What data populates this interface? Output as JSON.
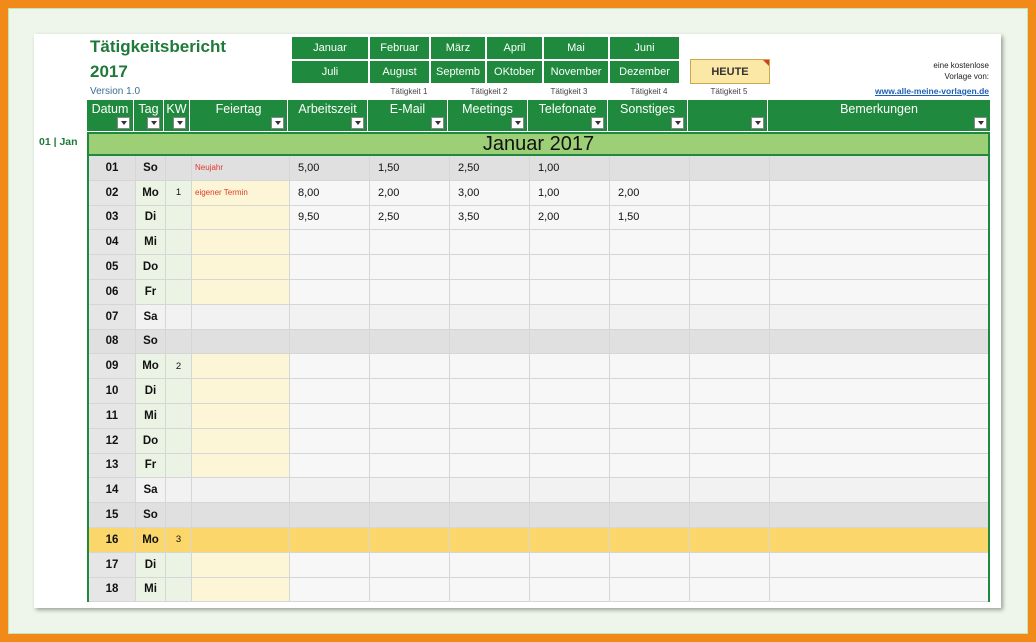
{
  "header": {
    "title_line1": "Tätigkeitsbericht",
    "title_line2": "2017",
    "version": "Version 1.0"
  },
  "months_row1": [
    "Januar",
    "Februar",
    "März",
    "April",
    "Mai",
    "Juni"
  ],
  "months_row2": [
    "Juli",
    "August",
    "Septemb",
    "OKtober",
    "November",
    "Dezember"
  ],
  "today_button": "HEUTE",
  "promo": {
    "line1": "eine kostenlose",
    "line2": "Vorlage von:",
    "link": "www.alle-meine-vorlagen.de"
  },
  "activity_labels": [
    "Tätigkeit 1",
    "Tätigkeit 2",
    "Tätigkeit 3",
    "Tätigkeit 4",
    "Tätigkeit 5"
  ],
  "columns": [
    "Datum",
    "Tag",
    "KW",
    "Feiertag",
    "Arbeitszeit",
    "E-Mail",
    "Meetings",
    "Telefonate",
    "Sonstiges",
    "",
    "Bemerkungen"
  ],
  "side_label": "01 | Jan",
  "month_title": "Januar 2017",
  "rows": [
    {
      "datum": "01",
      "tag": "So",
      "kw": "",
      "feiertag": "Neujahr",
      "arbeitszeit": "5,00",
      "email": "1,50",
      "meetings": "2,50",
      "telefonate": "1,00",
      "sonstiges": "",
      "t5": "",
      "bem": "",
      "kind": "sunday"
    },
    {
      "datum": "02",
      "tag": "Mo",
      "kw": "1",
      "feiertag": "eigener Termin",
      "arbeitszeit": "8,00",
      "email": "2,00",
      "meetings": "3,00",
      "telefonate": "1,00",
      "sonstiges": "2,00",
      "t5": "",
      "bem": "",
      "kind": "weekday"
    },
    {
      "datum": "03",
      "tag": "Di",
      "kw": "",
      "feiertag": "",
      "arbeitszeit": "9,50",
      "email": "2,50",
      "meetings": "3,50",
      "telefonate": "2,00",
      "sonstiges": "1,50",
      "t5": "",
      "bem": "",
      "kind": "weekday"
    },
    {
      "datum": "04",
      "tag": "Mi",
      "kw": "",
      "feiertag": "",
      "arbeitszeit": "",
      "email": "",
      "meetings": "",
      "telefonate": "",
      "sonstiges": "",
      "t5": "",
      "bem": "",
      "kind": "weekday"
    },
    {
      "datum": "05",
      "tag": "Do",
      "kw": "",
      "feiertag": "",
      "arbeitszeit": "",
      "email": "",
      "meetings": "",
      "telefonate": "",
      "sonstiges": "",
      "t5": "",
      "bem": "",
      "kind": "weekday"
    },
    {
      "datum": "06",
      "tag": "Fr",
      "kw": "",
      "feiertag": "",
      "arbeitszeit": "",
      "email": "",
      "meetings": "",
      "telefonate": "",
      "sonstiges": "",
      "t5": "",
      "bem": "",
      "kind": "weekday"
    },
    {
      "datum": "07",
      "tag": "Sa",
      "kw": "",
      "feiertag": "",
      "arbeitszeit": "",
      "email": "",
      "meetings": "",
      "telefonate": "",
      "sonstiges": "",
      "t5": "",
      "bem": "",
      "kind": "saturday"
    },
    {
      "datum": "08",
      "tag": "So",
      "kw": "",
      "feiertag": "",
      "arbeitszeit": "",
      "email": "",
      "meetings": "",
      "telefonate": "",
      "sonstiges": "",
      "t5": "",
      "bem": "",
      "kind": "sunday"
    },
    {
      "datum": "09",
      "tag": "Mo",
      "kw": "2",
      "feiertag": "",
      "arbeitszeit": "",
      "email": "",
      "meetings": "",
      "telefonate": "",
      "sonstiges": "",
      "t5": "",
      "bem": "",
      "kind": "weekday"
    },
    {
      "datum": "10",
      "tag": "Di",
      "kw": "",
      "feiertag": "",
      "arbeitszeit": "",
      "email": "",
      "meetings": "",
      "telefonate": "",
      "sonstiges": "",
      "t5": "",
      "bem": "",
      "kind": "weekday"
    },
    {
      "datum": "11",
      "tag": "Mi",
      "kw": "",
      "feiertag": "",
      "arbeitszeit": "",
      "email": "",
      "meetings": "",
      "telefonate": "",
      "sonstiges": "",
      "t5": "",
      "bem": "",
      "kind": "weekday"
    },
    {
      "datum": "12",
      "tag": "Do",
      "kw": "",
      "feiertag": "",
      "arbeitszeit": "",
      "email": "",
      "meetings": "",
      "telefonate": "",
      "sonstiges": "",
      "t5": "",
      "bem": "",
      "kind": "weekday"
    },
    {
      "datum": "13",
      "tag": "Fr",
      "kw": "",
      "feiertag": "",
      "arbeitszeit": "",
      "email": "",
      "meetings": "",
      "telefonate": "",
      "sonstiges": "",
      "t5": "",
      "bem": "",
      "kind": "weekday"
    },
    {
      "datum": "14",
      "tag": "Sa",
      "kw": "",
      "feiertag": "",
      "arbeitszeit": "",
      "email": "",
      "meetings": "",
      "telefonate": "",
      "sonstiges": "",
      "t5": "",
      "bem": "",
      "kind": "saturday"
    },
    {
      "datum": "15",
      "tag": "So",
      "kw": "",
      "feiertag": "",
      "arbeitszeit": "",
      "email": "",
      "meetings": "",
      "telefonate": "",
      "sonstiges": "",
      "t5": "",
      "bem": "",
      "kind": "sunday"
    },
    {
      "datum": "16",
      "tag": "Mo",
      "kw": "3",
      "feiertag": "",
      "arbeitszeit": "",
      "email": "",
      "meetings": "",
      "telefonate": "",
      "sonstiges": "",
      "t5": "",
      "bem": "",
      "kind": "today"
    },
    {
      "datum": "17",
      "tag": "Di",
      "kw": "",
      "feiertag": "",
      "arbeitszeit": "",
      "email": "",
      "meetings": "",
      "telefonate": "",
      "sonstiges": "",
      "t5": "",
      "bem": "",
      "kind": "weekday"
    },
    {
      "datum": "18",
      "tag": "Mi",
      "kw": "",
      "feiertag": "",
      "arbeitszeit": "",
      "email": "",
      "meetings": "",
      "telefonate": "",
      "sonstiges": "",
      "t5": "",
      "bem": "",
      "kind": "weekday"
    }
  ]
}
